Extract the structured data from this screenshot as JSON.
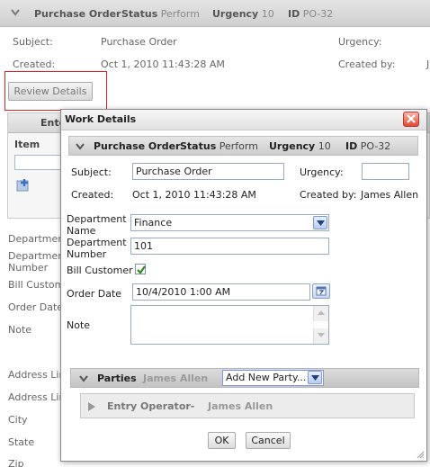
{
  "background": {
    "header": {
      "title": "Purchase Order",
      "status_label": "Status",
      "status_value": "Perform",
      "urgency_label": "Urgency",
      "urgency_value": "10",
      "id_label": "ID",
      "id_value": "PO-32"
    },
    "subject_label": "Subject:",
    "subject_value": "Purchase Order",
    "created_label": "Created:",
    "created_value": "Oct 1, 2010 11:43:28 AM",
    "urgency_label": "Urgency:",
    "created_by_label": "Created by:",
    "review_button": "Review Details",
    "panel_tab": "Ente",
    "panel_col": "Item",
    "left_labels": [
      "Department",
      "Department",
      "Number",
      "Bill Custome",
      "Order Date",
      "Note",
      "Address Lin",
      "Address Lin",
      "City",
      "State",
      "Zip"
    ]
  },
  "dialog": {
    "title": "Work Details",
    "header": {
      "title": "Purchase Order",
      "status_label": "Status",
      "status_value": "Perform",
      "urgency_label": "Urgency",
      "urgency_value": "10",
      "id_label": "ID",
      "id_value": "PO-32"
    },
    "subject_label": "Subject:",
    "subject_value": "Purchase Order",
    "urgency_label": "Urgency:",
    "urgency_value": "",
    "created_label": "Created:",
    "created_value": "Oct 1, 2010 11:43:28 AM",
    "created_by_label": "Created by:",
    "created_by_value": "James Allen",
    "department_name_label_1": "Department",
    "department_name_label_2": "Name",
    "department_name_value": "Finance",
    "department_number_label_1": "Department",
    "department_number_label_2": "Number",
    "department_number_value": "101",
    "bill_customer_label": "Bill Customer",
    "bill_customer_checked": true,
    "order_date_label": "Order Date",
    "order_date_value": "10/4/2010 1:00 AM",
    "note_label": "Note",
    "note_value": "",
    "parties_label": "Parties",
    "parties_owner": "James Allen",
    "add_party_value": "Add New Party...",
    "entry_operator_label": "Entry Operator-",
    "entry_operator_value": "James Allen",
    "ok_button": "OK",
    "cancel_button": "Cancel"
  },
  "icons": [
    "chevron-down-icon",
    "close-icon",
    "dropdown-arrow-icon",
    "checkmark-icon",
    "calendar-icon",
    "scroll-up-icon",
    "scroll-down-icon",
    "expand-triangle-icon",
    "add-row-icon",
    "resize-grip-icon"
  ]
}
